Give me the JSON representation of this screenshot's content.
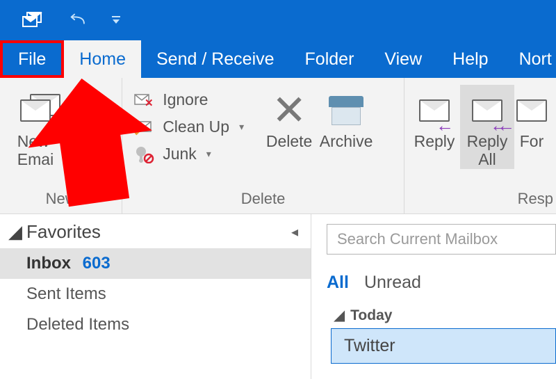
{
  "titlebar": {
    "icons": [
      "mail-stack",
      "undo",
      "customize-caret"
    ]
  },
  "menubar": {
    "tabs": [
      {
        "label": "File",
        "key": "file"
      },
      {
        "label": "Home",
        "key": "home"
      },
      {
        "label": "Send / Receive",
        "key": "sendreceive"
      },
      {
        "label": "Folder",
        "key": "folder"
      },
      {
        "label": "View",
        "key": "view"
      },
      {
        "label": "Help",
        "key": "help"
      },
      {
        "label": "Nort",
        "key": "norton"
      }
    ]
  },
  "ribbon": {
    "groups": {
      "new": {
        "label": "New",
        "new_email": "New\nEmai"
      },
      "delete": {
        "label": "Delete",
        "ignore": "Ignore",
        "cleanup": "Clean Up",
        "junk": "Junk",
        "delete_btn": "Delete",
        "archive": "Archive"
      },
      "respond": {
        "label": "Resp",
        "reply": "Reply",
        "reply_all": "Reply\nAll",
        "forward": "For"
      }
    }
  },
  "sidebar": {
    "favorites_label": "Favorites",
    "folders": [
      {
        "name": "Inbox",
        "count": 603,
        "selected": true
      },
      {
        "name": "Sent Items"
      },
      {
        "name": "Deleted Items"
      }
    ]
  },
  "reading": {
    "search_placeholder": "Search Current Mailbox",
    "filters": {
      "all": "All",
      "unread": "Unread"
    },
    "group_label": "Today",
    "messages": [
      {
        "sender": "Twitter"
      }
    ]
  }
}
